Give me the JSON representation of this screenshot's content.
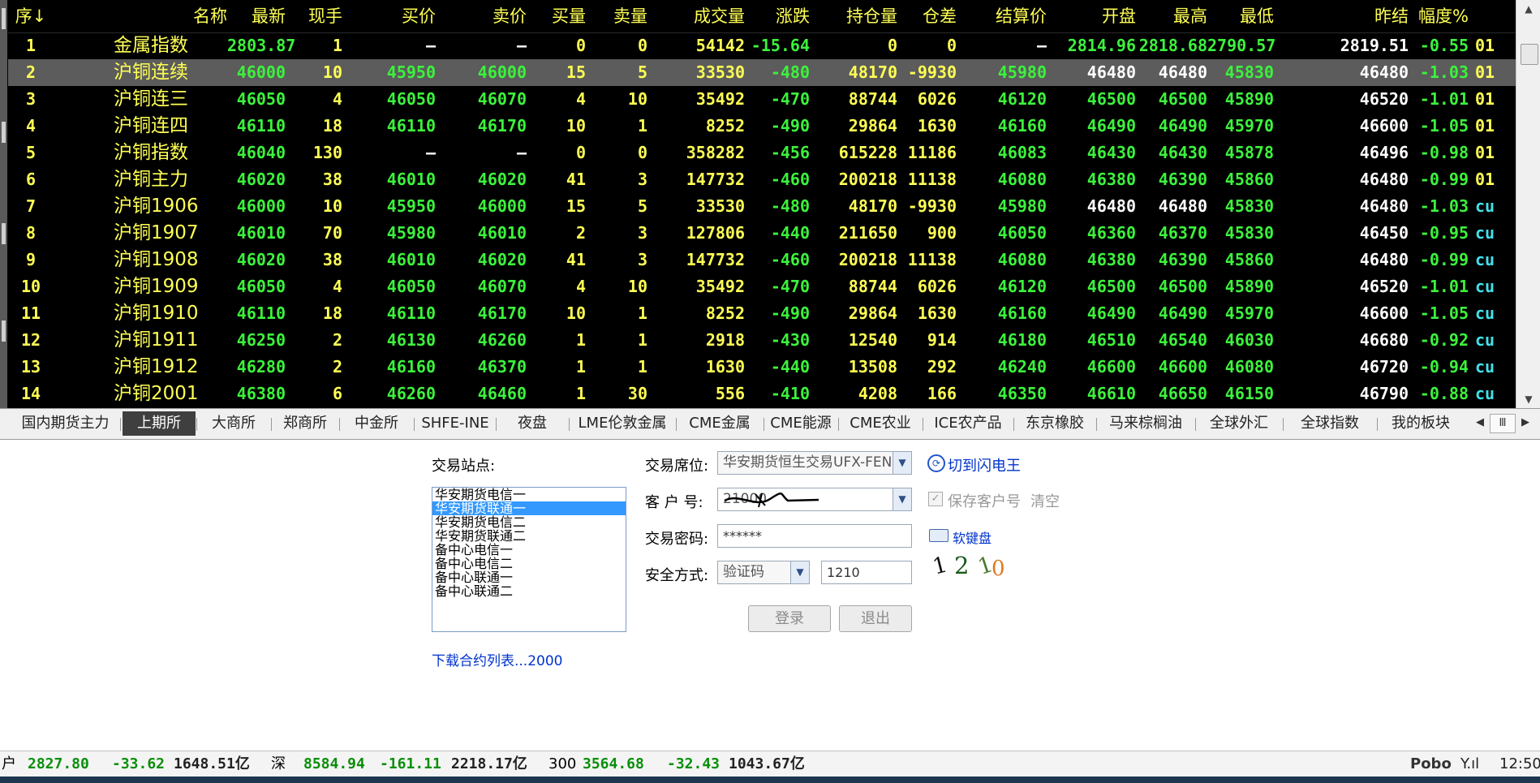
{
  "columns": [
    "序↓",
    "名称",
    "最新",
    "现手",
    "买价",
    "卖价",
    "买量",
    "卖量",
    "成交量",
    "涨跌",
    "持仓量",
    "仓差",
    "结算价",
    "开盘",
    "最高",
    "最低",
    "昨结",
    "幅度%"
  ],
  "rows": [
    {
      "seq": "1",
      "name": "金属指数",
      "latest": "2803.87",
      "cur": "1",
      "bid": "—",
      "ask": "—",
      "bidvol": "0",
      "askvol": "0",
      "vol": "54142",
      "chg": "-15.64",
      "oi": "0",
      "oidiff": "0",
      "settle": "—",
      "open": "2814.96",
      "high": "2818.68",
      "low": "2790.57",
      "prev": "2819.51",
      "pct": "-0.55",
      "extra": "01"
    },
    {
      "seq": "2",
      "name": "沪铜连续",
      "latest": "46000",
      "cur": "10",
      "bid": "45950",
      "ask": "46000",
      "bidvol": "15",
      "askvol": "5",
      "vol": "33530",
      "chg": "-480",
      "oi": "48170",
      "oidiff": "-9930",
      "settle": "45980",
      "open": "46480",
      "high": "46480",
      "low": "45830",
      "prev": "46480",
      "pct": "-1.03",
      "extra": "01"
    },
    {
      "seq": "3",
      "name": "沪铜连三",
      "latest": "46050",
      "cur": "4",
      "bid": "46050",
      "ask": "46070",
      "bidvol": "4",
      "askvol": "10",
      "vol": "35492",
      "chg": "-470",
      "oi": "88744",
      "oidiff": "6026",
      "settle": "46120",
      "open": "46500",
      "high": "46500",
      "low": "45890",
      "prev": "46520",
      "pct": "-1.01",
      "extra": "01"
    },
    {
      "seq": "4",
      "name": "沪铜连四",
      "latest": "46110",
      "cur": "18",
      "bid": "46110",
      "ask": "46170",
      "bidvol": "10",
      "askvol": "1",
      "vol": "8252",
      "chg": "-490",
      "oi": "29864",
      "oidiff": "1630",
      "settle": "46160",
      "open": "46490",
      "high": "46490",
      "low": "45970",
      "prev": "46600",
      "pct": "-1.05",
      "extra": "01"
    },
    {
      "seq": "5",
      "name": "沪铜指数",
      "latest": "46040",
      "cur": "130",
      "bid": "—",
      "ask": "—",
      "bidvol": "0",
      "askvol": "0",
      "vol": "358282",
      "chg": "-456",
      "oi": "615228",
      "oidiff": "11186",
      "settle": "46083",
      "open": "46430",
      "high": "46430",
      "low": "45878",
      "prev": "46496",
      "pct": "-0.98",
      "extra": "01"
    },
    {
      "seq": "6",
      "name": "沪铜主力",
      "latest": "46020",
      "cur": "38",
      "bid": "46010",
      "ask": "46020",
      "bidvol": "41",
      "askvol": "3",
      "vol": "147732",
      "chg": "-460",
      "oi": "200218",
      "oidiff": "11138",
      "settle": "46080",
      "open": "46380",
      "high": "46390",
      "low": "45860",
      "prev": "46480",
      "pct": "-0.99",
      "extra": "01"
    },
    {
      "seq": "7",
      "name": "沪铜1906",
      "latest": "46000",
      "cur": "10",
      "bid": "45950",
      "ask": "46000",
      "bidvol": "15",
      "askvol": "5",
      "vol": "33530",
      "chg": "-480",
      "oi": "48170",
      "oidiff": "-9930",
      "settle": "45980",
      "open": "46480",
      "high": "46480",
      "low": "45830",
      "prev": "46480",
      "pct": "-1.03",
      "extra": "cu"
    },
    {
      "seq": "8",
      "name": "沪铜1907",
      "latest": "46010",
      "cur": "70",
      "bid": "45980",
      "ask": "46010",
      "bidvol": "2",
      "askvol": "3",
      "vol": "127806",
      "chg": "-440",
      "oi": "211650",
      "oidiff": "900",
      "settle": "46050",
      "open": "46360",
      "high": "46370",
      "low": "45830",
      "prev": "46450",
      "pct": "-0.95",
      "extra": "cu"
    },
    {
      "seq": "9",
      "name": "沪铜1908",
      "latest": "46020",
      "cur": "38",
      "bid": "46010",
      "ask": "46020",
      "bidvol": "41",
      "askvol": "3",
      "vol": "147732",
      "chg": "-460",
      "oi": "200218",
      "oidiff": "11138",
      "settle": "46080",
      "open": "46380",
      "high": "46390",
      "low": "45860",
      "prev": "46480",
      "pct": "-0.99",
      "extra": "cu"
    },
    {
      "seq": "10",
      "name": "沪铜1909",
      "latest": "46050",
      "cur": "4",
      "bid": "46050",
      "ask": "46070",
      "bidvol": "4",
      "askvol": "10",
      "vol": "35492",
      "chg": "-470",
      "oi": "88744",
      "oidiff": "6026",
      "settle": "46120",
      "open": "46500",
      "high": "46500",
      "low": "45890",
      "prev": "46520",
      "pct": "-1.01",
      "extra": "cu"
    },
    {
      "seq": "11",
      "name": "沪铜1910",
      "latest": "46110",
      "cur": "18",
      "bid": "46110",
      "ask": "46170",
      "bidvol": "10",
      "askvol": "1",
      "vol": "8252",
      "chg": "-490",
      "oi": "29864",
      "oidiff": "1630",
      "settle": "46160",
      "open": "46490",
      "high": "46490",
      "low": "45970",
      "prev": "46600",
      "pct": "-1.05",
      "extra": "cu"
    },
    {
      "seq": "12",
      "name": "沪铜1911",
      "latest": "46250",
      "cur": "2",
      "bid": "46130",
      "ask": "46260",
      "bidvol": "1",
      "askvol": "1",
      "vol": "2918",
      "chg": "-430",
      "oi": "12540",
      "oidiff": "914",
      "settle": "46180",
      "open": "46510",
      "high": "46540",
      "low": "46030",
      "prev": "46680",
      "pct": "-0.92",
      "extra": "cu"
    },
    {
      "seq": "13",
      "name": "沪铜1912",
      "latest": "46280",
      "cur": "2",
      "bid": "46160",
      "ask": "46370",
      "bidvol": "1",
      "askvol": "1",
      "vol": "1630",
      "chg": "-440",
      "oi": "13508",
      "oidiff": "292",
      "settle": "46240",
      "open": "46600",
      "high": "46600",
      "low": "46080",
      "prev": "46720",
      "pct": "-0.94",
      "extra": "cu"
    },
    {
      "seq": "14",
      "name": "沪铜2001",
      "latest": "46380",
      "cur": "6",
      "bid": "46260",
      "ask": "46460",
      "bidvol": "1",
      "askvol": "30",
      "vol": "556",
      "chg": "-410",
      "oi": "4208",
      "oidiff": "166",
      "settle": "46350",
      "open": "46610",
      "high": "46650",
      "low": "46150",
      "prev": "46790",
      "pct": "-0.88",
      "extra": "cu"
    }
  ],
  "tabs": [
    "国内期货主力",
    "上期所",
    "大商所",
    "郑商所",
    "中金所",
    "SHFE-INE",
    "夜盘",
    "LME伦敦金属",
    "CME金属",
    "CME能源",
    "CME农业",
    "ICE农产品",
    "东京橡胶",
    "马来棕榈油",
    "全球外汇",
    "全球指数",
    "我的板块"
  ],
  "login": {
    "station_label": "交易站点:",
    "stations": [
      "华安期货电信一",
      "华安期货联通一",
      "华安期货电信二",
      "华安期货联通二",
      "备中心电信一",
      "备中心电信二",
      "备中心联通一",
      "备中心联通二"
    ],
    "seat_label": "交易席位:",
    "seat_value": "华安期货恒生交易UFX-FEN",
    "switch_link": "切到闪电王",
    "client_label": "客 户 号:",
    "client_value": "21000",
    "save_label": "保存客户号",
    "clear_label": "清空",
    "password_label": "交易密码:",
    "password_value": "******",
    "softkbd_label": "软键盘",
    "security_label": "安全方式:",
    "security_value": "验证码",
    "captcha_input": "1210",
    "captcha_chars": [
      "1",
      "2",
      "1",
      "0"
    ],
    "login_button": "登录",
    "exit_button": "退出",
    "download_link": "下载合约列表...2000"
  },
  "status": {
    "sh_label": "户",
    "sh_value": "2827.80",
    "sh_chg": "-33.62",
    "sh_amt": "1648.51亿",
    "sz_label": "深",
    "sz_value": "8584.94",
    "sz_chg": "-161.11",
    "sz_amt": "2218.17亿",
    "hs_label": "300",
    "hs_value": "3564.68",
    "hs_chg": "-32.43",
    "hs_amt": "1043.67亿",
    "brand": "Pobo",
    "signal": "Y.ıl",
    "time": "12:50"
  },
  "colors": {
    "up": "#ff3b3b",
    "down": "#3cf23c",
    "header": "#ffff54",
    "selected_row": "#5c5c5c"
  }
}
